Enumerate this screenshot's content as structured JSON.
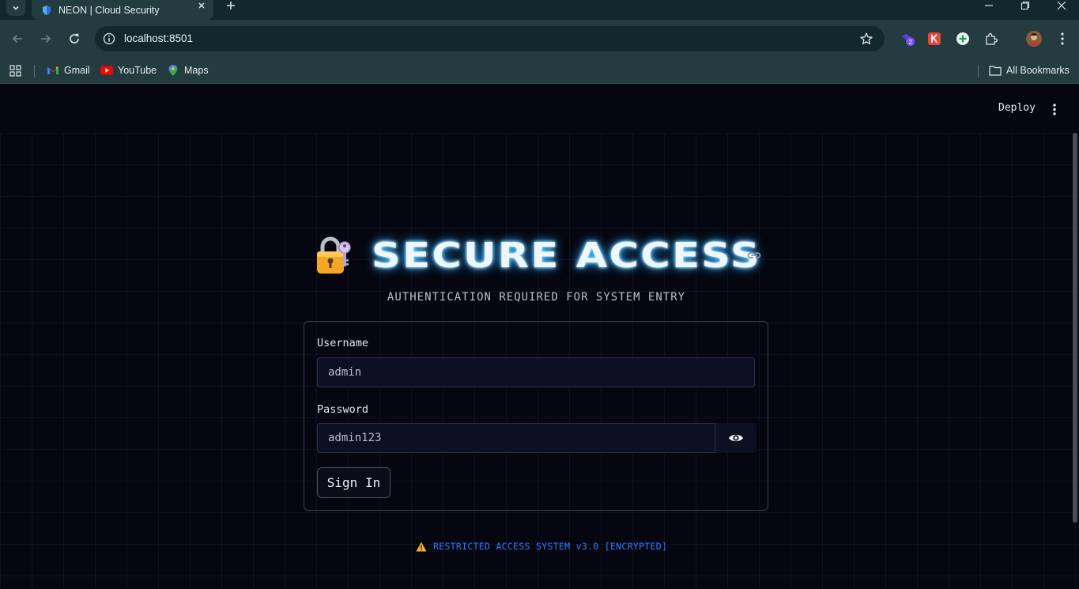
{
  "browser": {
    "tab_title": "NEON | Cloud Security",
    "url": "localhost:8501",
    "bookmarks": [
      {
        "label": "Gmail",
        "icon": "gmail-icon"
      },
      {
        "label": "YouTube",
        "icon": "youtube-icon"
      },
      {
        "label": "Maps",
        "icon": "maps-icon"
      }
    ],
    "all_bookmarks": "All Bookmarks",
    "extension_badge": "2"
  },
  "app": {
    "deploy_label": "Deploy",
    "title": "SECURE ACCESS",
    "subtitle": "AUTHENTICATION REQUIRED FOR SYSTEM ENTRY",
    "form": {
      "username_label": "Username",
      "username_value": "admin",
      "password_label": "Password",
      "password_value": "admin123",
      "submit_label": "Sign In"
    },
    "footer": "RESTRICTED ACCESS SYSTEM v3.0 [ENCRYPTED]"
  },
  "colors": {
    "background": "#05060f",
    "title_glow": "#2d9fff",
    "footer_text": "#2f7bff",
    "chrome": "#243b3f"
  }
}
